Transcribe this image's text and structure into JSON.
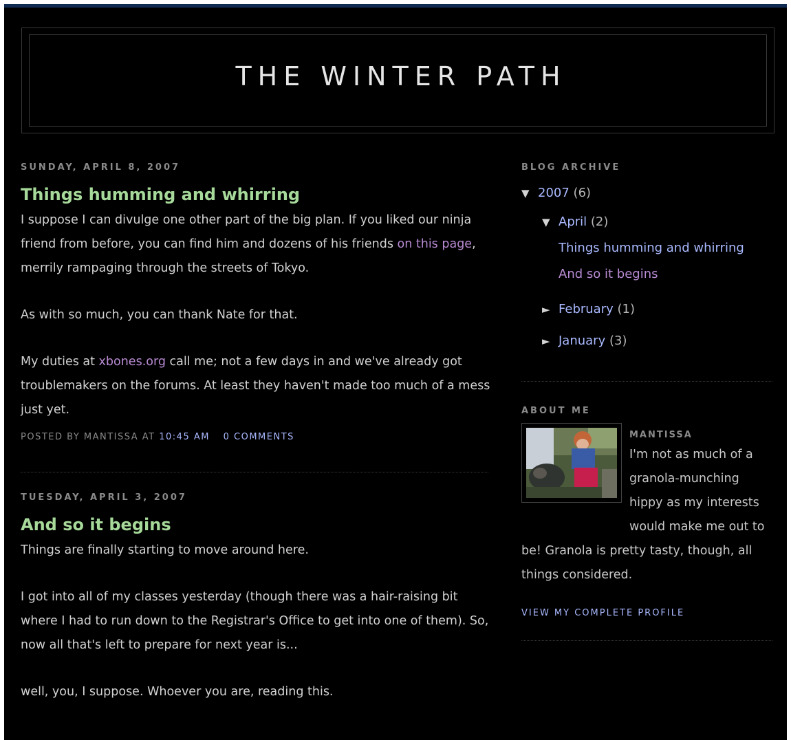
{
  "blog": {
    "title": "THE WINTER PATH"
  },
  "posts": [
    {
      "date": "SUNDAY, APRIL 8, 2007",
      "title": "Things humming and whirring",
      "p1_a": "I suppose I can divulge one other part of the big plan. If you liked our ninja friend from before, you can find him and dozens of his friends ",
      "p1_link": "on this page",
      "p1_b": ", merrily rampaging through the streets of Tokyo.",
      "p2": "As with so much, you can thank Nate for that.",
      "p3_a": "My duties at ",
      "p3_link": "xbones.org",
      "p3_b": " call me; not a few days in and we've already got troublemakers on the forums. At least they haven't made too much of a mess just yet.",
      "footer_posted_by": "POSTED BY MANTISSA AT",
      "footer_time": "10:45 AM",
      "footer_comments": "0 COMMENTS"
    },
    {
      "date": "TUESDAY, APRIL 3, 2007",
      "title": "And so it begins",
      "p1": "Things are finally starting to move around here.",
      "p2": "I got into all of my classes yesterday (though there was a hair-raising bit where I had to run down to the Registrar's Office to get into one of them). So, now all that's left to prepare for next year is...",
      "p3": "well, you, I suppose. Whoever you are, reading this."
    }
  ],
  "sidebar": {
    "archive_heading": "BLOG ARCHIVE",
    "year": {
      "label": "2007",
      "count": "(6)",
      "arrow": "▼"
    },
    "april": {
      "label": "April",
      "count": "(2)",
      "arrow": "▼"
    },
    "april_posts": [
      "Things humming and whirring",
      "And so it begins"
    ],
    "february": {
      "label": "February",
      "count": "(1)",
      "arrow": "►"
    },
    "january": {
      "label": "January",
      "count": "(3)",
      "arrow": "►"
    },
    "about_heading": "ABOUT ME",
    "profile_name": "MANTISSA",
    "profile_text": "I'm not as much of a granola-munching hippy as my interests would make me out to be! Granola is pretty tasty, though, all things considered.",
    "view_profile": "VIEW MY COMPLETE PROFILE"
  },
  "colors": {
    "background": "#000000",
    "title_green": "#a6d99a",
    "link_blue": "#a9b9ff",
    "link_purple": "#b88bd3",
    "text": "#d2d2d2",
    "muted": "#8a8a8a"
  }
}
